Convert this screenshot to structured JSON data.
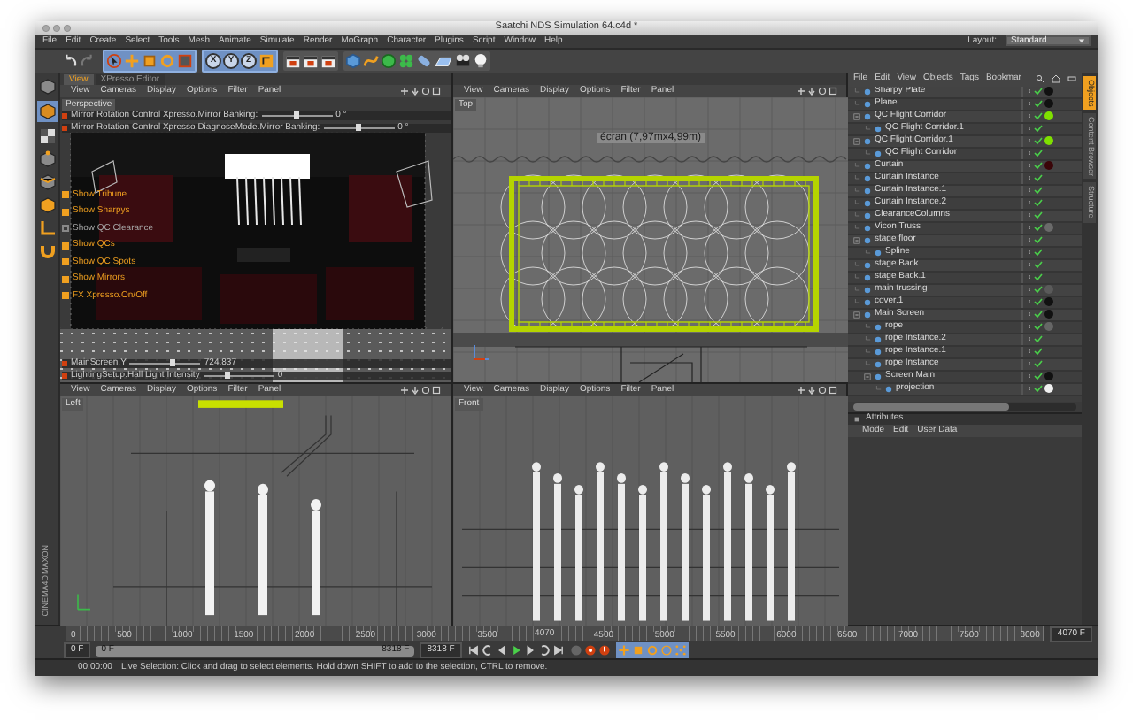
{
  "window": {
    "title": "Saatchi NDS Simulation 64.c4d *"
  },
  "menu_bar": [
    "File",
    "Edit",
    "Create",
    "Select",
    "Tools",
    "Mesh",
    "Animate",
    "Simulate",
    "Render",
    "MoGraph",
    "Character",
    "Plugins",
    "Script",
    "Window",
    "Help"
  ],
  "layout": {
    "label": "Layout:",
    "value": "Standard"
  },
  "axis_buttons": [
    "X",
    "Y",
    "Z"
  ],
  "logo": [
    "MAXON",
    "CINEMA4D"
  ],
  "viewports": [
    {
      "kind": "perspective",
      "camera": "Perspective",
      "tabs": [
        {
          "label": "View",
          "selected": true
        },
        {
          "label": "XPresso Editor",
          "selected": false
        }
      ],
      "menu": [
        "View",
        "Cameras",
        "Display",
        "Options",
        "Filter",
        "Panel"
      ],
      "hud": [
        {
          "kind": "slider",
          "label": "Mirror Rotation Control Xpresso.Mirror Banking:",
          "level": 0.5,
          "reading": "0 °"
        },
        {
          "kind": "slider",
          "label": "Mirror Rotation Control Xpresso DiagnoseMode.Mirror Banking:",
          "level": 0.5,
          "reading": "0 °"
        },
        {
          "kind": "toggle",
          "label": "Show Tribune",
          "on": true
        },
        {
          "kind": "toggle",
          "label": "Show Sharpys",
          "on": true
        },
        {
          "kind": "toggle",
          "label": "Show QC Clearance",
          "on": false
        },
        {
          "kind": "toggle",
          "label": "Show QCs",
          "on": true
        },
        {
          "kind": "toggle",
          "label": "Show QC Spots",
          "on": true
        },
        {
          "kind": "toggle",
          "label": "Show Mirrors",
          "on": true
        },
        {
          "kind": "toggle",
          "label": "FX Xpresso.On/Off",
          "on": true
        },
        {
          "kind": "slider",
          "label": "MainScreen.Y",
          "level": 0.6,
          "reading": "724.837"
        },
        {
          "kind": "slider",
          "label": "LightingSetup.Hall Light Intensity",
          "level": 0.35,
          "reading": "0"
        }
      ]
    },
    {
      "kind": "top",
      "camera": "Top",
      "menu": [
        "View",
        "Cameras",
        "Display",
        "Options",
        "Filter",
        "Panel"
      ],
      "caption": "écran (7,97mx4,99m)"
    },
    {
      "kind": "side",
      "camera": "Left",
      "menu": [
        "View",
        "Cameras",
        "Display",
        "Options",
        "Filter",
        "Panel"
      ]
    },
    {
      "kind": "front",
      "camera": "Front",
      "menu": [
        "View",
        "Cameras",
        "Display",
        "Options",
        "Filter",
        "Panel"
      ]
    }
  ],
  "objects": {
    "menu": [
      "File",
      "Edit",
      "View",
      "Objects",
      "Tags",
      "Bookmar"
    ],
    "side_tabs": [
      {
        "label": "Objects",
        "selected": true
      },
      {
        "label": "Content Browser",
        "selected": false
      },
      {
        "label": "Structure",
        "selected": false
      }
    ],
    "items": [
      {
        "name": "Sharpy Plate",
        "color": "#111111"
      },
      {
        "name": "Plane",
        "color": "#111111"
      },
      {
        "name": "QC Flight Corridor",
        "color": "#7fe000",
        "expanded": true,
        "children": [
          {
            "name": "QC Flight Corridor.1"
          }
        ]
      },
      {
        "name": "QC Flight Corridor.1",
        "color": "#7fe000",
        "expanded": true,
        "children": [
          {
            "name": "QC Flight Corridor"
          }
        ]
      },
      {
        "name": "Curtain",
        "color": "#3a0508"
      },
      {
        "name": "Curtain Instance"
      },
      {
        "name": "Curtain Instance.1"
      },
      {
        "name": "Curtain Instance.2"
      },
      {
        "name": "ClearanceColumns"
      },
      {
        "name": "Vicon Truss",
        "color": "#6a6a6a"
      },
      {
        "name": "stage floor",
        "expanded": true,
        "children": [
          {
            "name": "Spline"
          }
        ]
      },
      {
        "name": "stage Back"
      },
      {
        "name": "stage Back.1"
      },
      {
        "name": "main trussing",
        "color": "#5a5a5a"
      },
      {
        "name": "cover.1",
        "color": "#111111"
      },
      {
        "name": "Main Screen",
        "color": "#111111",
        "expanded": true,
        "children": [
          {
            "name": "rope",
            "color": "#666666"
          },
          {
            "name": "rope Instance.2"
          },
          {
            "name": "rope Instance.1"
          },
          {
            "name": "rope Instance"
          },
          {
            "name": "Screen Main",
            "color": "#111111",
            "expanded": true,
            "children": [
              {
                "name": "projection",
                "color": "#f0f0f0"
              }
            ]
          }
        ]
      }
    ]
  },
  "attributes": {
    "title": "Attributes",
    "menu": [
      "Mode",
      "Edit",
      "User Data"
    ]
  },
  "timeline": {
    "ticks": [
      "0",
      "500",
      "1000",
      "1500",
      "2000",
      "2500",
      "3000",
      "3500",
      "4500",
      "5000",
      "5500",
      "6000",
      "6500",
      "7000",
      "7500",
      "8000"
    ],
    "level": 0.489,
    "playhead": "4070",
    "current_frame": "4070 F"
  },
  "transport": {
    "start": "0 F",
    "level": 1,
    "range_start": "0 F",
    "range_end": "8318 F",
    "end": "8318 F"
  },
  "status": {
    "time": "00:00:00",
    "message": "Live Selection: Click and drag to select elements. Hold down SHIFT to add to the selection, CTRL to remove."
  }
}
